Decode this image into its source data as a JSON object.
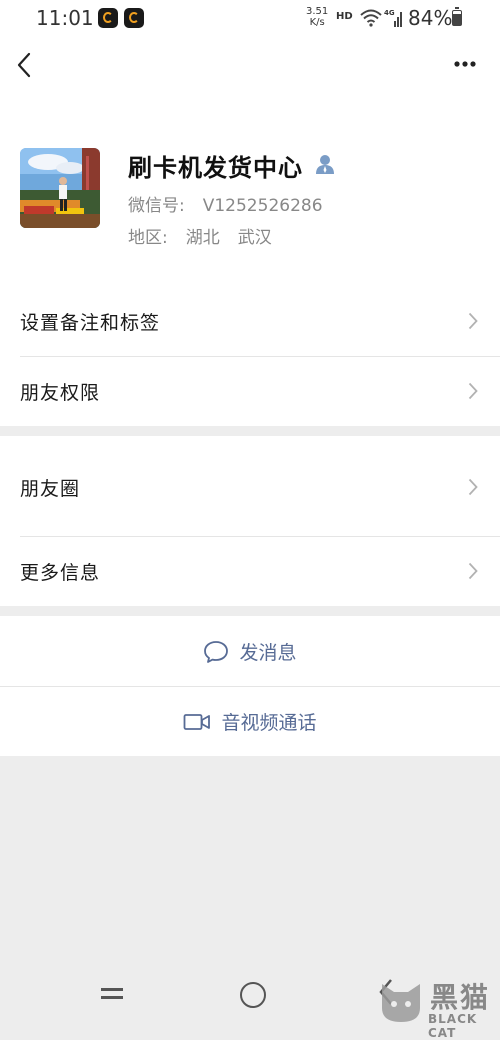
{
  "statusbar": {
    "time": "11:01",
    "net_speed_value": "3.51",
    "net_speed_unit": "K/s",
    "hd": "HD",
    "network": "4G",
    "battery": "84%",
    "battery_level": 0.84
  },
  "header": {
    "back_icon": "chevron-left-icon",
    "more_icon": "ellipsis-icon"
  },
  "profile": {
    "name": "刷卡机发货中心",
    "wechat_id_label": "微信号:",
    "wechat_id": "V1252526286",
    "region_label": "地区:",
    "province": "湖北",
    "city": "武汉"
  },
  "settings_group": {
    "items": [
      {
        "label": "设置备注和标签"
      },
      {
        "label": "朋友权限"
      }
    ]
  },
  "info_group": {
    "items": [
      {
        "label": "朋友圈"
      },
      {
        "label": "更多信息"
      }
    ]
  },
  "actions": {
    "message": "发消息",
    "video_call": "音视频通话"
  },
  "watermark": {
    "main": "黑猫",
    "sub": "BLACK CAT"
  },
  "colors": {
    "link_blue": "#576b95",
    "background": "#ededed"
  }
}
